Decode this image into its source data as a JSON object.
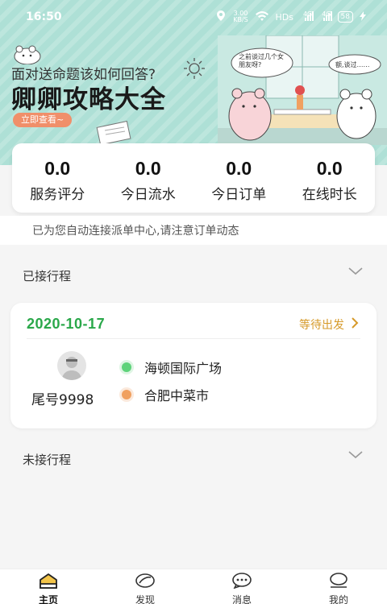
{
  "status_bar": {
    "time": "16:50",
    "network_speed": "3.00 KB/S",
    "hd_label": "HDs",
    "signal_1": "4G",
    "signal_2": "4G",
    "battery": "58"
  },
  "banner": {
    "subtitle": "面对送命题该如何回答?",
    "title": "卿卿攻略大全",
    "button_label": "立即查看~",
    "bubble_left": "之前谈过几个女朋友呀?",
    "bubble_right": "额,谈过……"
  },
  "stats": [
    {
      "value": "0.0",
      "label": "服务评分"
    },
    {
      "value": "0.0",
      "label": "今日流水"
    },
    {
      "value": "0.0",
      "label": "今日订单"
    },
    {
      "value": "0.0",
      "label": "在线时长"
    }
  ],
  "notice": "已为您自动连接派单中心,请注意订单动态",
  "accepted_section": {
    "title": "已接行程"
  },
  "trip": {
    "date": "2020-10-17",
    "status": "等待出发",
    "tail_number": "尾号9998",
    "origin": "海顿国际广场",
    "destination": "合肥中菜市"
  },
  "pending_section": {
    "title": "未接行程"
  },
  "tabs": [
    {
      "label": "主页",
      "icon": "home-icon",
      "active": true
    },
    {
      "label": "发现",
      "icon": "discover-icon",
      "active": false
    },
    {
      "label": "消息",
      "icon": "message-icon",
      "active": false
    },
    {
      "label": "我的",
      "icon": "profile-icon",
      "active": false
    }
  ],
  "colors": {
    "banner_bg": "#aee0d6",
    "accent_green": "#2aa84a",
    "status_orange": "#d69a2a",
    "button_orange": "#f08f6a"
  }
}
